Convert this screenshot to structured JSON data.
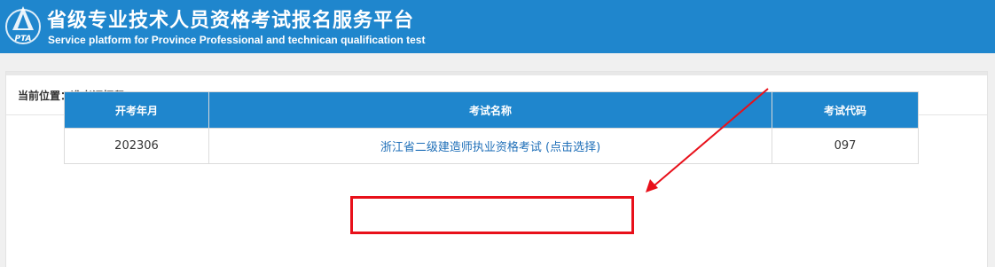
{
  "header": {
    "logo_text": "PTA",
    "title": "省级专业技术人员资格考试报名服务平台",
    "subtitle": "Service platform for Province Professional and technican qualification test"
  },
  "breadcrumb": {
    "text": "当前位置：准考证打印"
  },
  "table": {
    "columns": [
      "开考年月",
      "考试名称",
      "考试代码"
    ],
    "rows": [
      {
        "year_month": "202306",
        "exam_name": "浙江省二级建造师执业资格考试 (点击选择)",
        "exam_code": "097"
      }
    ]
  },
  "colors": {
    "header_blue": "#1f86cd",
    "link_blue": "#1f6fb8",
    "annotation_red": "#e8101a"
  },
  "icons": {
    "logo": "pta-logo-icon"
  }
}
